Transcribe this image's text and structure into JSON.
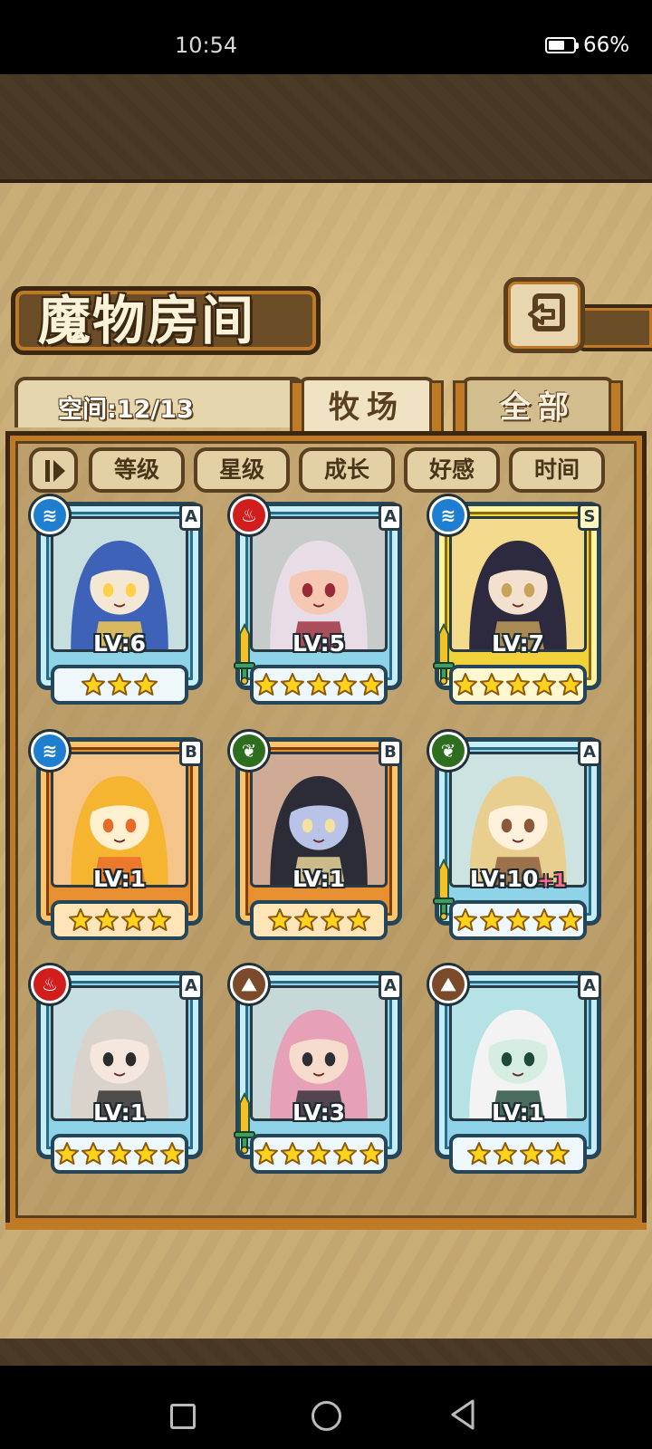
{
  "status_bar": {
    "time": "10:54",
    "battery": "66%",
    "battery_level": 0.66
  },
  "header": {
    "title": "魔物房间",
    "back_icon": "return-arrow-icon"
  },
  "space": {
    "label": "空间:12/13"
  },
  "tabs": [
    {
      "label": "牧场",
      "active": true
    },
    {
      "label": "全部",
      "active": false
    }
  ],
  "filters": {
    "toggle_icon": "sort-toggle-icon",
    "items": [
      "等级",
      "星级",
      "成长",
      "好感",
      "时间"
    ]
  },
  "monsters": [
    {
      "element": "water",
      "rank": "A",
      "level": "LV:6",
      "bonus": "",
      "stars": 3,
      "frame": "blue",
      "sword": false
    },
    {
      "element": "fire",
      "rank": "A",
      "level": "LV:5",
      "bonus": "",
      "stars": 5,
      "frame": "blue",
      "sword": true
    },
    {
      "element": "water",
      "rank": "S",
      "level": "LV:7",
      "bonus": "",
      "stars": 5,
      "frame": "gold",
      "sword": true
    },
    {
      "element": "water",
      "rank": "B",
      "level": "LV:1",
      "bonus": "",
      "stars": 4,
      "frame": "orange",
      "sword": false
    },
    {
      "element": "wood",
      "rank": "B",
      "level": "LV:1",
      "bonus": "",
      "stars": 4,
      "frame": "orange",
      "sword": false
    },
    {
      "element": "wood",
      "rank": "A",
      "level": "LV:10",
      "bonus": "+1",
      "stars": 5,
      "frame": "blue",
      "sword": true
    },
    {
      "element": "fire",
      "rank": "A",
      "level": "LV:1",
      "bonus": "",
      "stars": 5,
      "frame": "blue",
      "sword": false
    },
    {
      "element": "earth",
      "rank": "A",
      "level": "LV:3",
      "bonus": "",
      "stars": 5,
      "frame": "blue",
      "sword": true
    },
    {
      "element": "earth",
      "rank": "A",
      "level": "LV:1",
      "bonus": "",
      "stars": 4,
      "frame": "blue",
      "sword": false
    }
  ],
  "colors": {
    "panel": "#c9ad77",
    "frame_dark": "#5a4020",
    "accent": "#c07a26",
    "star": "#ffd21c"
  }
}
